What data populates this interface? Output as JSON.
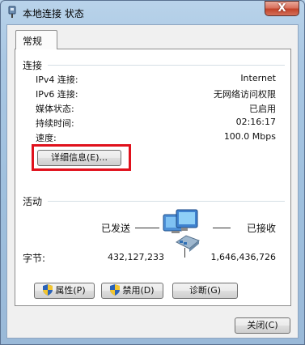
{
  "window": {
    "title": "本地连接 状态",
    "close_glyph": "X",
    "title_icon": "network-adapter-icon"
  },
  "tabs": [
    {
      "label": "常规"
    }
  ],
  "connection": {
    "section_label": "连接",
    "rows": [
      {
        "label": "IPv4 连接:",
        "value": "Internet"
      },
      {
        "label": "IPv6 连接:",
        "value": "无网络访问权限"
      },
      {
        "label": "媒体状态:",
        "value": "已启用"
      },
      {
        "label": "持续时间:",
        "value": "02:16:17"
      },
      {
        "label": "速度:",
        "value": "100.0 Mbps"
      }
    ],
    "details_button": "详细信息(E)..."
  },
  "activity": {
    "section_label": "活动",
    "sent_label": "已发送",
    "received_label": "已接收",
    "bytes_label": "字节:",
    "bytes_sent": "432,127,233",
    "bytes_received": "1,646,436,726",
    "icon": "network-computers-icon"
  },
  "actions": {
    "properties": "属性(P)",
    "disable": "禁用(D)",
    "diagnose": "诊断(G)"
  },
  "footer": {
    "close_button": "关闭(C)"
  },
  "colors": {
    "highlight_border": "#e0111c",
    "window_frame": "#a9c7e3",
    "close_button": "#c2432a"
  }
}
